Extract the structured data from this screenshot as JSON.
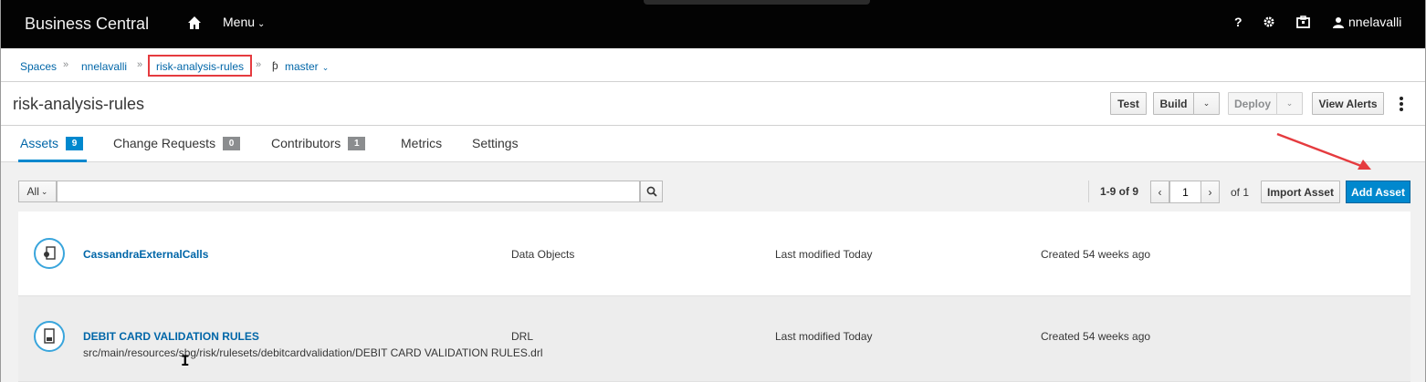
{
  "topnav": {
    "brand": "Business Central",
    "menu_label": "Menu",
    "help_label": "?",
    "user_name": "nnelavalli"
  },
  "breadcrumb": {
    "items": [
      "Spaces",
      "nnelavalli",
      "risk-analysis-rules",
      "master"
    ],
    "separator": "»"
  },
  "project": {
    "title": "risk-analysis-rules",
    "buttons": {
      "test": "Test",
      "build": "Build",
      "deploy": "Deploy",
      "view_alerts": "View Alerts"
    }
  },
  "tabs": [
    {
      "label": "Assets",
      "badge": "9",
      "active": true
    },
    {
      "label": "Change Requests",
      "badge": "0",
      "active": false
    },
    {
      "label": "Contributors",
      "badge": "1",
      "active": false
    },
    {
      "label": "Metrics",
      "badge": null,
      "active": false
    },
    {
      "label": "Settings",
      "badge": null,
      "active": false
    }
  ],
  "toolbar": {
    "filter_selected": "All",
    "search_value": "",
    "pagination_range": "1-9 of 9",
    "current_page": "1",
    "total_pages_label": "of 1",
    "import_label": "Import Asset",
    "add_label": "Add Asset"
  },
  "assets": [
    {
      "name": "CassandraExternalCalls",
      "path": "",
      "type": "Data Objects",
      "modified": "Last modified Today",
      "created": "Created 54 weeks ago",
      "icon": "data-object-icon"
    },
    {
      "name": "DEBIT CARD VALIDATION RULES",
      "path": "src/main/resources/sbg/risk/rulesets/debitcardvalidation/DEBIT CARD VALIDATION RULES.drl",
      "type": "DRL",
      "modified": "Last modified Today",
      "created": "Created 54 weeks ago",
      "icon": "drl-file-icon"
    }
  ],
  "colors": {
    "topbar": "#030303",
    "link": "#0066a8",
    "primary": "#0088ce",
    "highlight": "#e53b3f"
  }
}
